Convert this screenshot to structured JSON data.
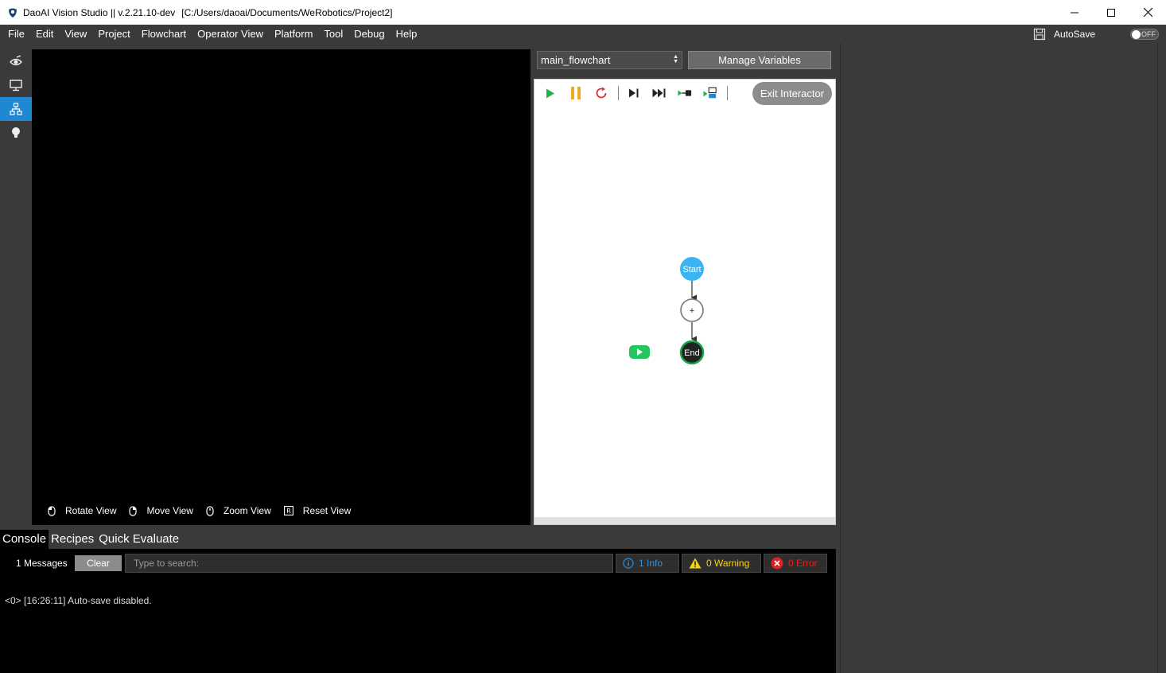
{
  "window": {
    "app_title": "DaoAI Vision Studio || v.2.21.10-dev",
    "project_path": "[C:/Users/daoai/Documents/WeRobotics/Project2]"
  },
  "menu": [
    "File",
    "Edit",
    "View",
    "Project",
    "Flowchart",
    "Operator View",
    "Platform",
    "Tool",
    "Debug",
    "Help"
  ],
  "autosave": {
    "label": "AutoSave",
    "toggle_text": "OFF"
  },
  "rail": {
    "items": [
      "camera-icon",
      "monitor-icon",
      "flowchart-icon",
      "lightbulb-icon"
    ],
    "active": "flowchart-icon"
  },
  "view_controls": [
    "Rotate View",
    "Move View",
    "Zoom View",
    "Reset View"
  ],
  "flowchart": {
    "selected": "main_flowchart",
    "manage_variables": "Manage Variables",
    "exit_interactor": "Exit Interactor",
    "nodes": {
      "start": "Start",
      "add": "+",
      "end": "End"
    },
    "colors": {
      "run": "#22b14c",
      "pause": "#f5a623",
      "restart": "#e03030",
      "start_node": "#3ab4f2",
      "end_ring": "#16a34a"
    }
  },
  "bottom_tabs": [
    "Console",
    "Recipes",
    "Quick Evaluate"
  ],
  "console": {
    "message_count": "1 Messages",
    "clear": "Clear",
    "search_placeholder": "Type to search:",
    "info": "1 Info",
    "warning": "0 Warning",
    "error": "0 Error",
    "log": "<0> [16:26:11] Auto-save disabled."
  }
}
